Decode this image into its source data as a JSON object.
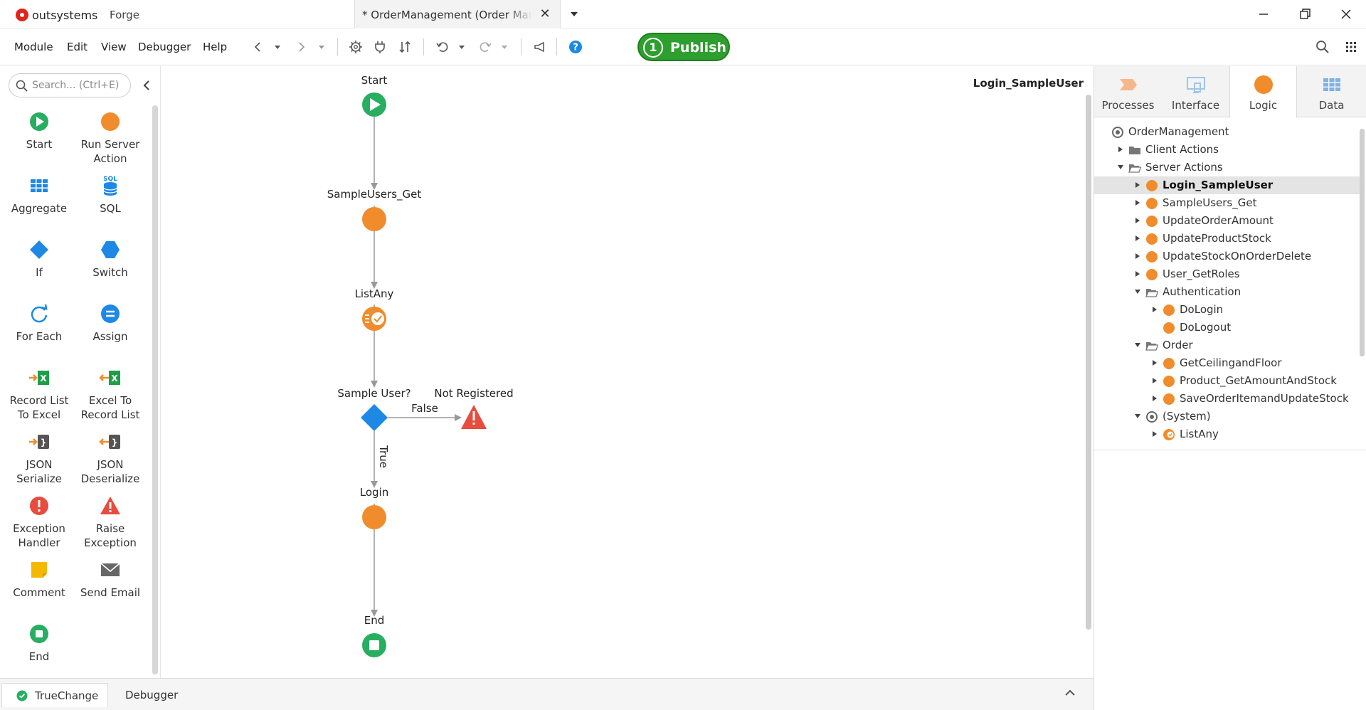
{
  "titlebar": {
    "brand": "outsystems",
    "forge": "Forge",
    "tab_title": "* OrderManagement (Order Management)"
  },
  "menu": {
    "items": [
      "Module",
      "Edit",
      "View",
      "Debugger",
      "Help"
    ],
    "publish_count": "1",
    "publish_label": "Publish"
  },
  "toolbox": {
    "search_placeholder": "Search... (Ctrl+E)",
    "items": [
      {
        "label": "Start",
        "icon": "start-icon"
      },
      {
        "label": "Run Server\nAction",
        "icon": "run-server-action-icon"
      },
      {
        "label": "Aggregate",
        "icon": "aggregate-icon"
      },
      {
        "label": "SQL",
        "icon": "sql-icon"
      },
      {
        "label": "If",
        "icon": "if-icon"
      },
      {
        "label": "Switch",
        "icon": "switch-icon"
      },
      {
        "label": "For Each",
        "icon": "for-each-icon"
      },
      {
        "label": "Assign",
        "icon": "assign-icon"
      },
      {
        "label": "Record List\nTo Excel",
        "icon": "record-list-to-excel-icon"
      },
      {
        "label": "Excel To\nRecord List",
        "icon": "excel-to-record-list-icon"
      },
      {
        "label": "JSON\nSerialize",
        "icon": "json-serialize-icon"
      },
      {
        "label": "JSON\nDeserialize",
        "icon": "json-deserialize-icon"
      },
      {
        "label": "Exception\nHandler",
        "icon": "exception-handler-icon"
      },
      {
        "label": "Raise\nException",
        "icon": "raise-exception-icon"
      },
      {
        "label": "Comment",
        "icon": "comment-icon"
      },
      {
        "label": "Send Email",
        "icon": "send-email-icon"
      },
      {
        "label": "End",
        "icon": "end-icon"
      }
    ]
  },
  "canvas": {
    "action_name": "Login_SampleUser",
    "nodes": {
      "start": "Start",
      "sampleusers_get": "SampleUsers_Get",
      "listany": "ListAny",
      "sample_user": "Sample User?",
      "not_registered": "Not Registered",
      "login": "Login",
      "end": "End"
    },
    "edges": {
      "false_label": "False",
      "true_label": "True"
    }
  },
  "right_panel": {
    "tabs": [
      "Processes",
      "Interface",
      "Logic",
      "Data"
    ],
    "active_tab": "Logic",
    "tree": [
      {
        "label": "OrderManagement",
        "level": 0,
        "arrow": "none",
        "icon": "module"
      },
      {
        "label": "Client Actions",
        "level": 1,
        "arrow": "right",
        "icon": "folder"
      },
      {
        "label": "Server Actions",
        "level": 1,
        "arrow": "down",
        "icon": "folder-open"
      },
      {
        "label": "Login_SampleUser",
        "level": 2,
        "arrow": "right",
        "icon": "action",
        "selected": true
      },
      {
        "label": "SampleUsers_Get",
        "level": 2,
        "arrow": "right",
        "icon": "action"
      },
      {
        "label": "UpdateOrderAmount",
        "level": 2,
        "arrow": "right",
        "icon": "action"
      },
      {
        "label": "UpdateProductStock",
        "level": 2,
        "arrow": "right",
        "icon": "action"
      },
      {
        "label": "UpdateStockOnOrderDelete",
        "level": 2,
        "arrow": "right",
        "icon": "action"
      },
      {
        "label": "User_GetRoles",
        "level": 2,
        "arrow": "right",
        "icon": "action"
      },
      {
        "label": "Authentication",
        "level": 2,
        "arrow": "down",
        "icon": "folder-open"
      },
      {
        "label": "DoLogin",
        "level": 3,
        "arrow": "right",
        "icon": "action"
      },
      {
        "label": "DoLogout",
        "level": 3,
        "arrow": "none",
        "icon": "action"
      },
      {
        "label": "Order",
        "level": 2,
        "arrow": "down",
        "icon": "folder-open"
      },
      {
        "label": "GetCeilingandFloor",
        "level": 3,
        "arrow": "right",
        "icon": "action"
      },
      {
        "label": "Product_GetAmountAndStock",
        "level": 3,
        "arrow": "right",
        "icon": "action"
      },
      {
        "label": "SaveOrderItemandUpdateStock",
        "level": 3,
        "arrow": "right",
        "icon": "action"
      },
      {
        "label": "(System)",
        "level": 2,
        "arrow": "down",
        "icon": "module"
      },
      {
        "label": "ListAny",
        "level": 3,
        "arrow": "right",
        "icon": "listany"
      }
    ]
  },
  "bottom": {
    "tabs": [
      "TrueChange",
      "Debugger"
    ]
  },
  "colors": {
    "green": "#27ae60",
    "orange": "#f08c2b",
    "blue": "#1e88e5",
    "red": "#e74c3c",
    "publish": "#2e9e2e"
  }
}
